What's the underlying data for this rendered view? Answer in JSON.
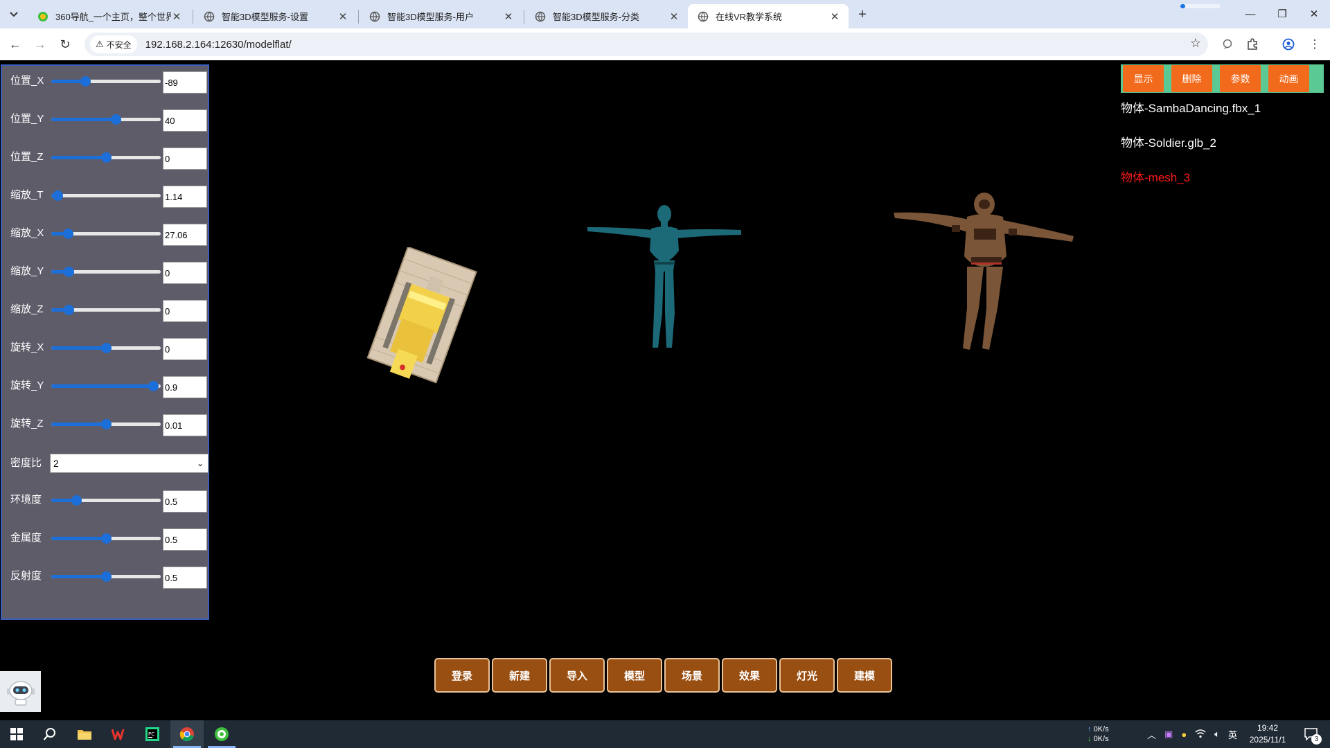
{
  "browser": {
    "tabs": [
      {
        "title": "360导航_一个主页，整个世界",
        "favicon": "360-icon"
      },
      {
        "title": "智能3D模型服务-设置",
        "favicon": "globe-icon"
      },
      {
        "title": "智能3D模型服务-用户",
        "favicon": "globe-icon"
      },
      {
        "title": "智能3D模型服务-分类",
        "favicon": "globe-icon"
      },
      {
        "title": "在线VR教学系统",
        "favicon": "globe-icon",
        "active": true
      }
    ],
    "security_label": "不安全",
    "url": "192.168.2.164:12630/modelflat/"
  },
  "panel": {
    "rows": [
      {
        "label": "位置_X",
        "value": "-89",
        "slider": 0.31
      },
      {
        "label": "位置_Y",
        "value": "40",
        "slider": 0.59
      },
      {
        "label": "位置_Z",
        "value": "0",
        "slider": 0.5
      },
      {
        "label": "缩放_T",
        "value": "1.14",
        "slider": 0.06
      },
      {
        "label": "缩放_X",
        "value": "27.06",
        "slider": 0.15
      },
      {
        "label": "缩放_Y",
        "value": "0",
        "slider": 0.16
      },
      {
        "label": "缩放_Z",
        "value": "0",
        "slider": 0.16
      },
      {
        "label": "旋转_X",
        "value": "0",
        "slider": 0.5
      },
      {
        "label": "旋转_Y",
        "value": "0.9",
        "slider": 0.93
      },
      {
        "label": "旋转_Z",
        "value": "0.01",
        "slider": 0.5
      }
    ],
    "density": {
      "label": "密度比",
      "value": "2"
    },
    "material_rows": [
      {
        "label": "环境度",
        "value": "0.5",
        "slider": 0.23
      },
      {
        "label": "金属度",
        "value": "0.5",
        "slider": 0.5
      },
      {
        "label": "反射度",
        "value": "0.5",
        "slider": 0.5
      }
    ]
  },
  "top_buttons": [
    "显示",
    "删除",
    "参数",
    "动画"
  ],
  "objects": [
    {
      "name": "物体-SambaDancing.fbx_1",
      "selected": false
    },
    {
      "name": "物体-Soldier.glb_2",
      "selected": false
    },
    {
      "name": "物体-mesh_3",
      "selected": true
    }
  ],
  "bottom_menu": [
    "登录",
    "新建",
    "导入",
    "模型",
    "场景",
    "效果",
    "灯光",
    "建模"
  ],
  "taskbar": {
    "net_up": "0K/s",
    "net_down": "0K/s",
    "ime": "英",
    "time": "19:42",
    "date": "2025/11/1",
    "notifications": "3"
  },
  "colors": {
    "panel_bg": "#5e5c69",
    "slider_accent": "#1c6ed8",
    "top_button": "#f26b1d",
    "top_button_bar": "#5ac994",
    "bottom_button": "#9a4f12",
    "selected_object": "#ff1a1a",
    "mannequin": "#1c6a78"
  }
}
